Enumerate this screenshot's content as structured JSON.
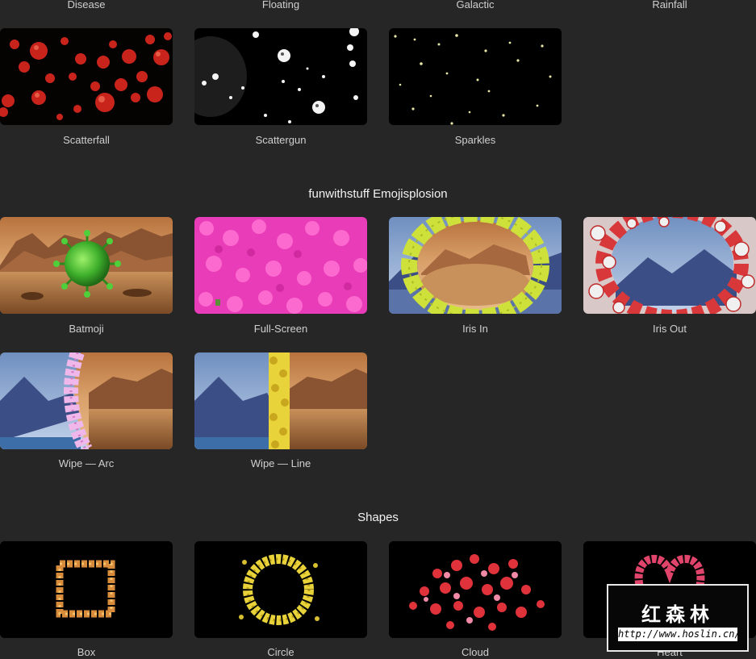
{
  "top_labels": [
    "Disease",
    "Floating",
    "Galactic",
    "Rainfall"
  ],
  "row1": {
    "items": [
      {
        "label": "Scatterfall"
      },
      {
        "label": "Scattergun"
      },
      {
        "label": "Sparkles"
      }
    ]
  },
  "emojisplosion": {
    "title": "funwithstuff Emojisplosion",
    "items": [
      {
        "label": "Batmoji"
      },
      {
        "label": "Full-Screen"
      },
      {
        "label": "Iris In"
      },
      {
        "label": "Iris Out"
      },
      {
        "label": "Wipe — Arc"
      },
      {
        "label": "Wipe — Line"
      }
    ]
  },
  "shapes": {
    "title": "Shapes",
    "items": [
      {
        "label": "Box"
      },
      {
        "label": "Circle"
      },
      {
        "label": "Cloud"
      },
      {
        "label": "Heart"
      }
    ]
  },
  "watermark": {
    "title": "红森林",
    "url": "http://www.hoslin.cn/"
  },
  "colors": {
    "background": "#262626",
    "label": "#cfcfcf",
    "section_title": "#f2f2f2"
  }
}
